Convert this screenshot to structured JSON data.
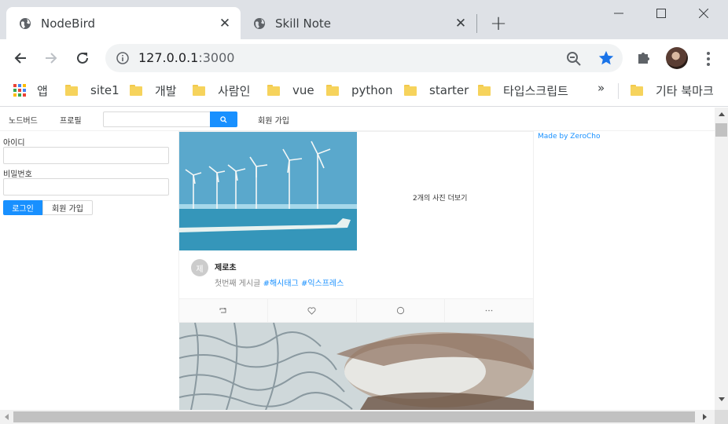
{
  "browser": {
    "tabs": [
      {
        "title": "NodeBird",
        "active": true
      },
      {
        "title": "Skill Note",
        "active": false
      }
    ],
    "new_tab_label": "+",
    "url": {
      "host": "127.0.0.1",
      "port": ":3000"
    },
    "bookmarks": [
      "앱",
      "site1",
      "개발",
      "사람인",
      "vue",
      "python",
      "starter",
      "타입스크립트"
    ],
    "bookmarks_overflow": "»",
    "other_bookmarks": "기타 북마크",
    "accent_color": "#1a73e8"
  },
  "site": {
    "menu": {
      "home": "노드버드",
      "profile": "프로필",
      "search_placeholder": "",
      "signup": "회원 가입"
    },
    "login": {
      "id_label": "아이디",
      "password_label": "비밀번호",
      "login_button": "로그인",
      "signup_button": "회원 가입"
    },
    "post": {
      "more_photos": "2개의 사진 더보기",
      "avatar_initial": "제",
      "author": "제로초",
      "content_text": "첫번째 게시글 ",
      "hashtags": [
        "#해시태그",
        "#익스프레스"
      ]
    },
    "footer_link": "Made by ZeroCho",
    "primary_color": "#1890ff"
  }
}
